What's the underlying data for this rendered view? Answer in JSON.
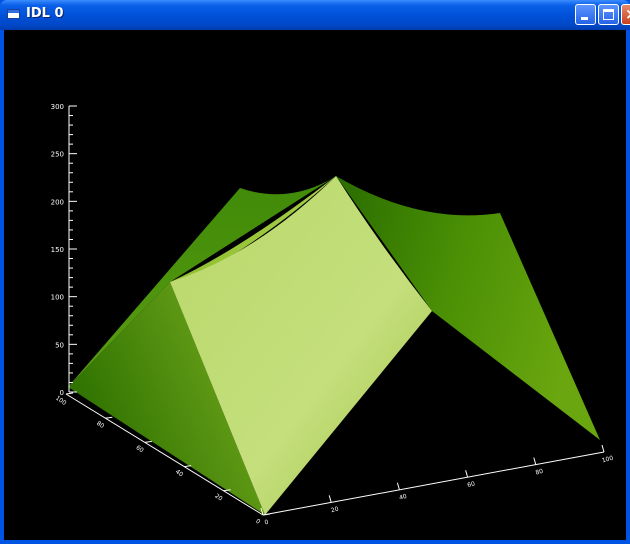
{
  "window": {
    "title": "IDL 0",
    "controls": {
      "minimize": "minimize",
      "maximize": "maximize",
      "close": "close"
    }
  },
  "plot": {
    "z_ticks": [
      "0",
      "50",
      "100",
      "150",
      "200",
      "250",
      "300"
    ],
    "x_ticks": [
      "0",
      "20",
      "40",
      "60",
      "80",
      "100"
    ],
    "y_ticks": [
      "100",
      "80",
      "60",
      "40",
      "20",
      "0"
    ],
    "colors": {
      "background": "#000000",
      "axis": "#ffffff",
      "surface_light": "#c4dd7a",
      "surface_dark": "#2f7a00"
    }
  }
}
